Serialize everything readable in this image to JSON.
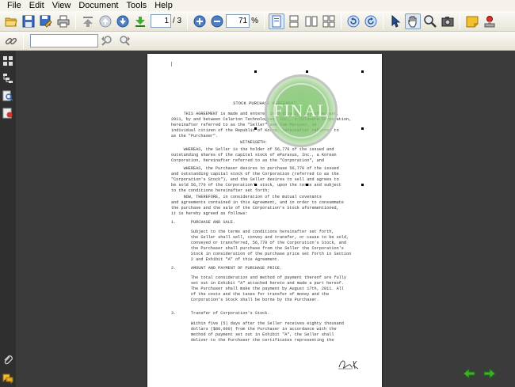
{
  "menu": [
    "File",
    "Edit",
    "View",
    "Document",
    "Tools",
    "Help"
  ],
  "toolbar": {
    "page_current": "1",
    "page_total": "/ 3",
    "zoom_value": "71",
    "zoom_unit": "%"
  },
  "search": {
    "value": ""
  },
  "document": {
    "title": "STOCK PURCHASE AGREEMENT",
    "stamp_text": "FINAL",
    "paragraphs": [
      "     THIS AGREEMENT is made and entered into this 5th day of August,\n2011, by and between Celarton Technologies, Inc., a Delaware Corporation,\nhereinafter referred to as the \"Seller\" and Tom Marquez, an\nindividual citizen of the Republic of Korea, hereinafter referred to\nas the \"Purchaser\".",
      "                            WITNESSETH:",
      "     WHEREAS, the Seller is the holder of 56,770 of the issued and\noutstanding shares of the capital stock of eParaxus, Inc., a Korean\nCorporation, hereinafter referred to as the \"Corporation\", and",
      "     WHEREAS, the Purchaser desires to purchase 56,770 of the issued\nand outstanding capital stock of the Corporation (referred to as the\n\"Corporation's Stock\"), and the Seller desires to sell and agrees to\nbe sold 56,770 of the Corporation's stock, upon the terms and subject\nto the conditions hereinafter set forth;",
      "     NOW, THEREFORE, in consideration of the mutual covenants\nand agreements contained in this Agreement, and in order to consummate\nthe purchase and the sale of the Corporation's Stock aforementioned,\nit is hereby agreed as follows:",
      "1.      PURCHASE AND SALE.",
      "        Subject to the terms and conditions hereinafter set forth,\n        the Seller shall sell, convey and transfer, or cause to be sold,\n        conveyed or transferred, 56,770 of the Corporation's Stock, and\n        the Purchaser shall purchase from the Seller the Corporation's\n        Stock in consideration of the purchase price set forth in Section\n        2 and Exhibit \"A\" of this Agreement.",
      "2.      AMOUNT AND PAYMENT OF PURCHASE PRICE.",
      "        The total consideration and method of payment thereof are fully\n        set out in Exhibit \"A\" attached hereto and made a part hereof.\n        The Purchaser shall make the payment by August 17th, 2011. All\n        of the costs and the taxes for transfer of money and the\n        Corporation's Stock shall be borne by the Purchaser.",
      "3.      Transfer of Corporation's Stock.",
      "        Within five (5) days after the Seller receives eighty thousand\n        dollars ($80,000) from the Purchaser in accordance with the\n        method of payment set out in Exhibit \"A\", the Seller shall\n        deliver to the Purchaser the certificates representing the"
    ]
  },
  "colors": {
    "viewport_bg": "#3b3b3b",
    "sidebar_bg": "#2f2f2f",
    "toolbar_bg": "#ece9d8",
    "nav_arrow": "#3fae2a",
    "stamp": "#7ec86e"
  }
}
